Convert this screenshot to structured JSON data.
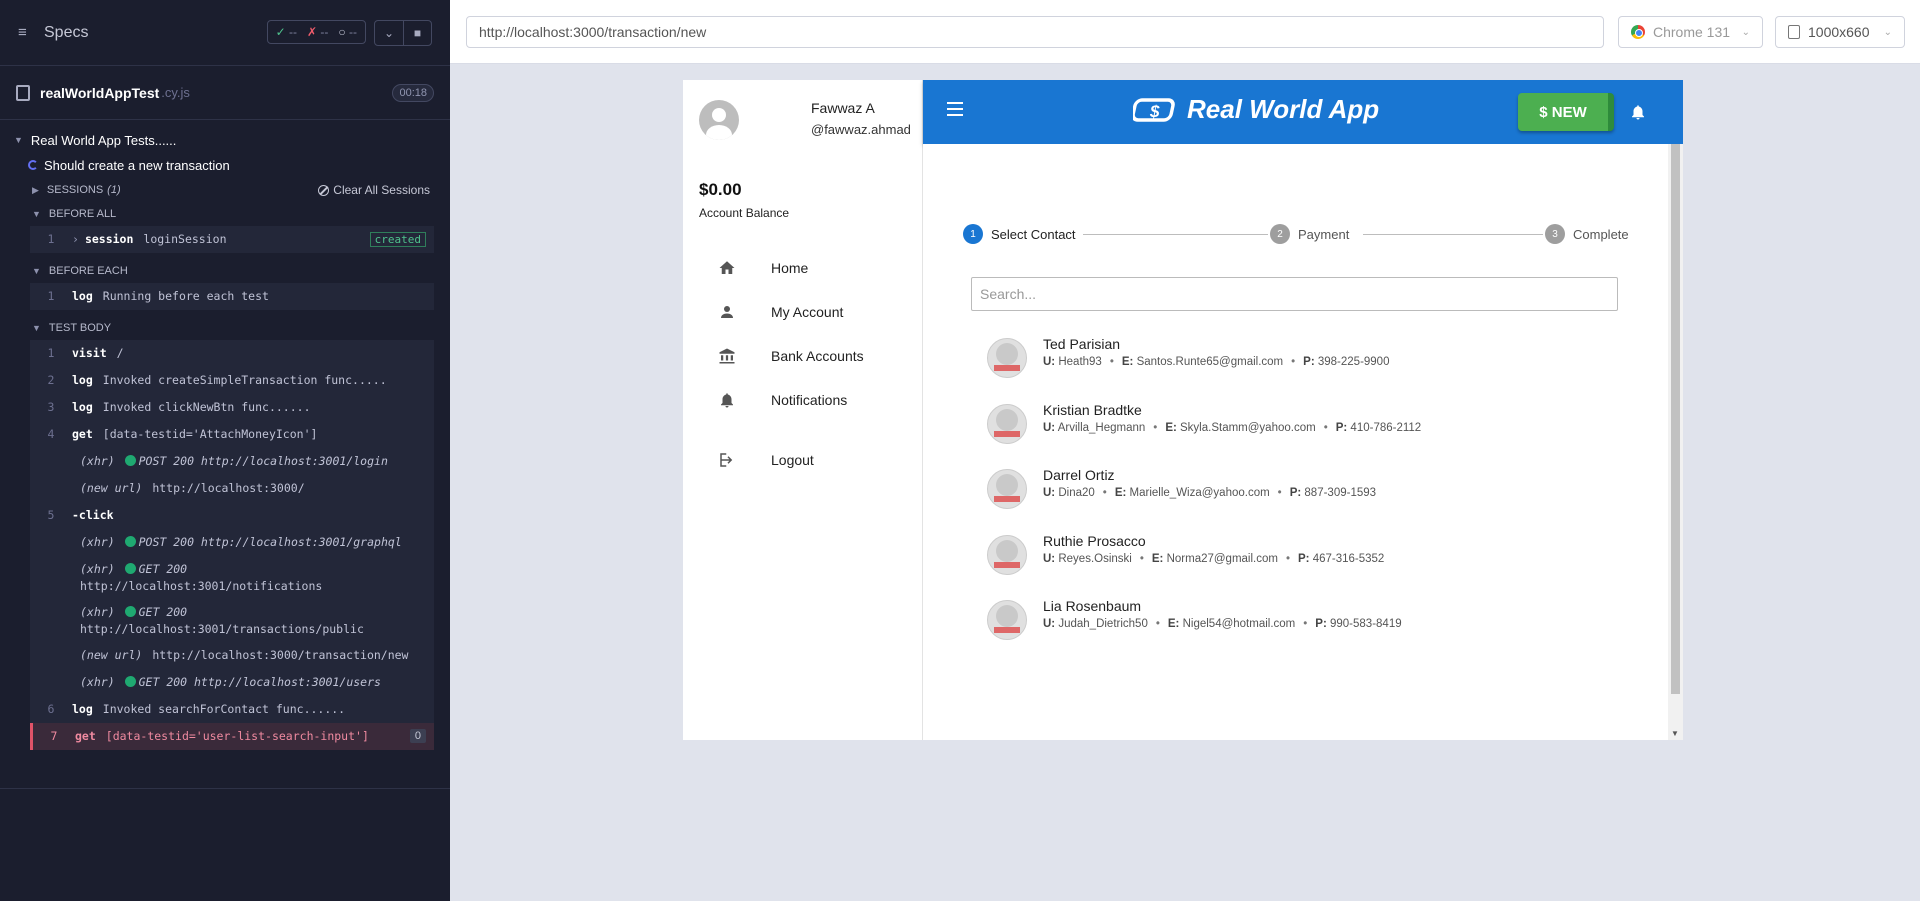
{
  "runner": {
    "specs_label": "Specs",
    "stats": {
      "passed": "--",
      "failed": "--",
      "pending": "--"
    },
    "spec_file": {
      "name": "realWorldAppTest",
      "ext": ".cy.js",
      "duration": "00:18"
    },
    "suite_title": "Real World App Tests......",
    "test_title": "Should create a new transaction",
    "sessions": {
      "label": "SESSIONS",
      "count": "(1)",
      "clear_label": "Clear All Sessions"
    },
    "before_all": {
      "label": "BEFORE ALL",
      "commands": [
        {
          "num": "1",
          "name": "session",
          "msg": "loginSession",
          "badge": "created"
        }
      ]
    },
    "before_each": {
      "label": "BEFORE EACH",
      "commands": [
        {
          "num": "1",
          "name": "log",
          "msg": "Running before each test"
        }
      ]
    },
    "test_body": {
      "label": "TEST BODY",
      "commands": [
        {
          "num": "1",
          "name": "visit",
          "msg": "/"
        },
        {
          "num": "2",
          "name": "log",
          "msg": "Invoked createSimpleTransaction func....."
        },
        {
          "num": "3",
          "name": "log",
          "msg": "Invoked clickNewBtn func......"
        },
        {
          "num": "4",
          "name": "get",
          "msg": "[data-testid='AttachMoneyIcon']"
        },
        {
          "label": "(xhr)",
          "text": "POST 200 http://localhost:3001/login"
        },
        {
          "label": "(new url)",
          "text": "http://localhost:3000/"
        },
        {
          "num": "5",
          "name": "-click",
          "msg": ""
        },
        {
          "label": "(xhr)",
          "text": "POST 200 http://localhost:3001/graphql"
        },
        {
          "label": "(xhr)",
          "text": "GET 200",
          "url": "http://localhost:3001/notifications"
        },
        {
          "label": "(xhr)",
          "text": "GET 200",
          "url": "http://localhost:3001/transactions/public"
        },
        {
          "label": "(new url)",
          "text": "http://localhost:3000/transaction/new"
        },
        {
          "label": "(xhr)",
          "text": "GET 200 http://localhost:3001/users"
        },
        {
          "num": "6",
          "name": "log",
          "msg": "Invoked searchForContact func......"
        },
        {
          "num": "7",
          "name": "get",
          "msg": "[data-testid='user-list-search-input']",
          "count": "0"
        }
      ]
    }
  },
  "preview": {
    "url": "http://localhost:3000/transaction/new",
    "browser": "Chrome 131",
    "viewport": "1000x660"
  },
  "app": {
    "title": "Real World App",
    "new_button": "$ NEW",
    "user": {
      "full_name": "Fawwaz A",
      "handle": "@fawwaz.ahmad"
    },
    "balance": "$0.00",
    "balance_label": "Account Balance",
    "nav": [
      {
        "label": "Home",
        "icon": "home-icon"
      },
      {
        "label": "My Account",
        "icon": "person-icon"
      },
      {
        "label": "Bank Accounts",
        "icon": "bank-icon"
      },
      {
        "label": "Notifications",
        "icon": "bell-icon"
      },
      {
        "label": "Logout",
        "icon": "logout-icon"
      }
    ],
    "steps": [
      {
        "num": "1",
        "label": "Select Contact"
      },
      {
        "num": "2",
        "label": "Payment"
      },
      {
        "num": "3",
        "label": "Complete"
      }
    ],
    "search_placeholder": "Search...",
    "contacts": [
      {
        "name": "Ted Parisian",
        "username": "Heath93",
        "email": "Santos.Runte65@gmail.com",
        "phone": "398-225-9900"
      },
      {
        "name": "Kristian Bradtke",
        "username": "Arvilla_Hegmann",
        "email": "Skyla.Stamm@yahoo.com",
        "phone": "410-786-2112"
      },
      {
        "name": "Darrel Ortiz",
        "username": "Dina20",
        "email": "Marielle_Wiza@yahoo.com",
        "phone": "887-309-1593"
      },
      {
        "name": "Ruthie Prosacco",
        "username": "Reyes.Osinski",
        "email": "Norma27@gmail.com",
        "phone": "467-316-5352"
      },
      {
        "name": "Lia Rosenbaum",
        "username": "Judah_Dietrich50",
        "email": "Nigel54@hotmail.com",
        "phone": "990-583-8419"
      }
    ],
    "labels": {
      "u": "U:",
      "e": "E:",
      "p": "P:",
      "dot": "•"
    }
  }
}
